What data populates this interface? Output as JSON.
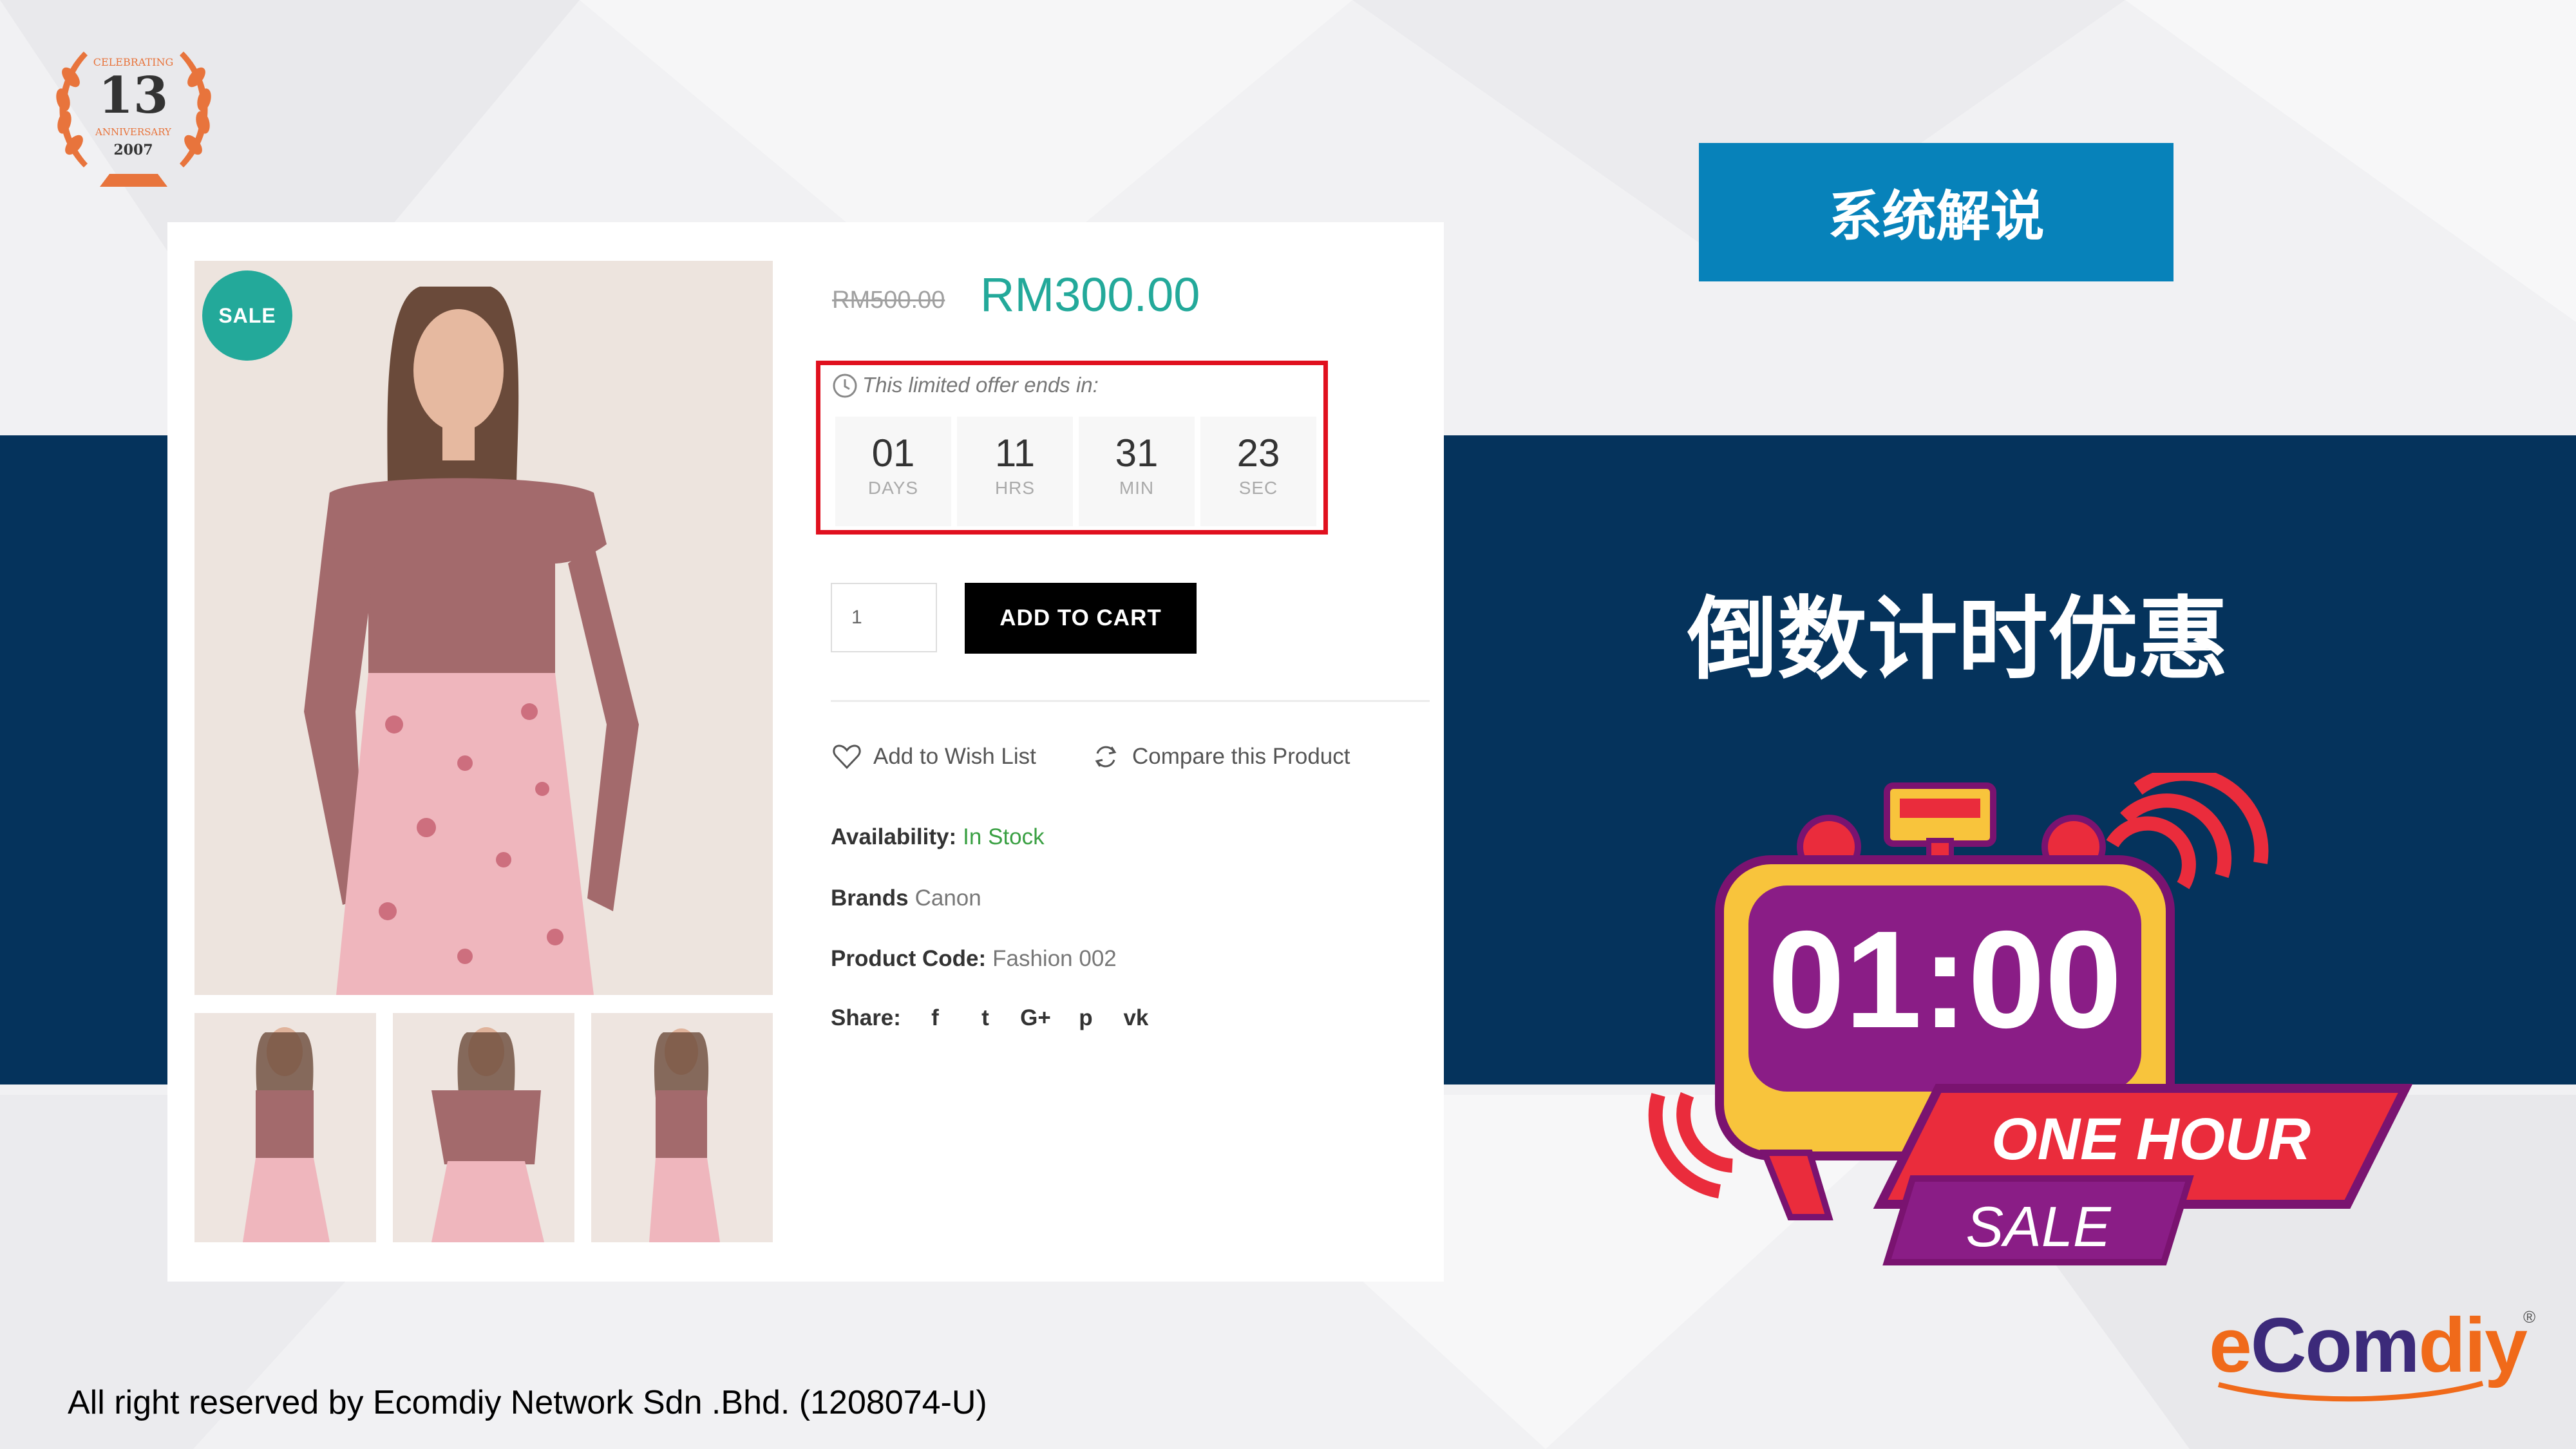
{
  "badge": {
    "top_text": "CELEBRATING",
    "number": "13",
    "sub_text": "ANNIVERSARY",
    "year": "2007"
  },
  "product": {
    "sale_badge": "SALE",
    "old_price": "RM500.00",
    "new_price": "RM300.00",
    "offer_text": "This limited offer ends in:",
    "countdown": [
      {
        "value": "01",
        "unit": "DAYS"
      },
      {
        "value": "11",
        "unit": "HRS"
      },
      {
        "value": "31",
        "unit": "MIN"
      },
      {
        "value": "23",
        "unit": "SEC"
      }
    ],
    "quantity": "1",
    "add_to_cart": "ADD TO CART",
    "wishlist": "Add to Wish List",
    "compare": "Compare this Product",
    "availability_label": "Availability:",
    "availability_value": "In Stock",
    "brands_label": "Brands",
    "brands_value": "Canon",
    "code_label": "Product Code:",
    "code_value": "Fashion 002",
    "share_label": "Share:",
    "share_icons": [
      "facebook-icon",
      "twitter-icon",
      "google-plus-icon",
      "pinterest-icon",
      "vk-icon"
    ],
    "share_glyphs": [
      "f",
      "t",
      "G+",
      "p",
      "vk"
    ]
  },
  "right": {
    "section_button": "系统解说",
    "headline": "倒数计时优惠",
    "timer_display": "01:00",
    "banner_line1": "ONE HOUR",
    "banner_line2": "SALE"
  },
  "logo": {
    "part1": "e",
    "part2": "Com",
    "part3": "diy",
    "reg": "®"
  },
  "footer": "All right reserved by Ecomdiy Network Sdn .Bhd. (1208074-U)",
  "colors": {
    "navy": "#05335c",
    "teal": "#23a99a",
    "blue_button": "#0782ba",
    "red_outline": "#e0101e",
    "purple": "#8a1d86",
    "orange": "#f06a1a"
  }
}
